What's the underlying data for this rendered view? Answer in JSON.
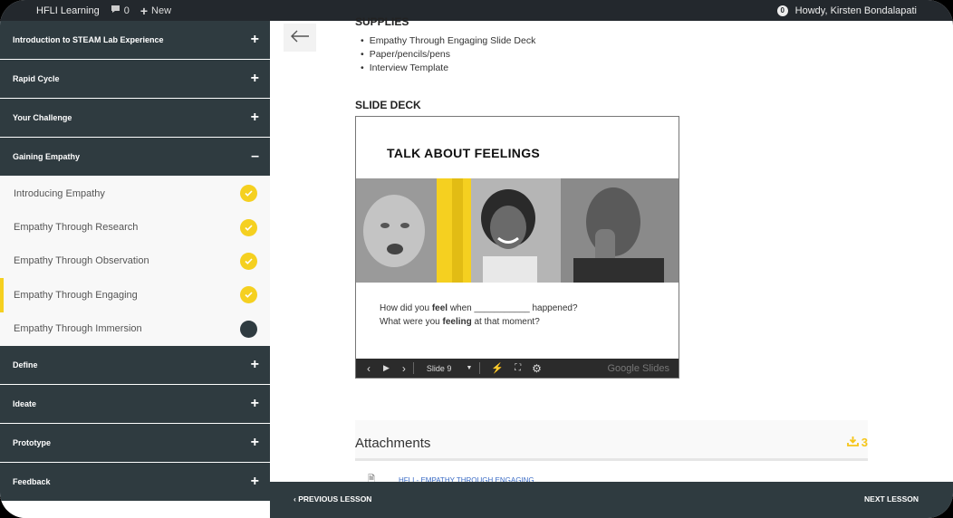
{
  "admin_bar": {
    "site_title": "HFLI Learning",
    "comments_count": "0",
    "new_label": "New",
    "notifications_count": "0",
    "greeting": "Howdy, Kirsten Bondalapati"
  },
  "sidebar": {
    "sections_top": [
      {
        "label": "Introduction to STEAM Lab Experience",
        "symbol": "+"
      },
      {
        "label": "Rapid Cycle",
        "symbol": "+"
      },
      {
        "label": "Your Challenge",
        "symbol": "+"
      },
      {
        "label": "Gaining Empathy",
        "symbol": "–"
      }
    ],
    "lessons": [
      {
        "label": "Introducing Empathy",
        "status": "complete"
      },
      {
        "label": "Empathy Through Research",
        "status": "complete"
      },
      {
        "label": "Empathy Through Observation",
        "status": "complete"
      },
      {
        "label": "Empathy Through Engaging",
        "status": "complete"
      },
      {
        "label": "Empathy Through Immersion",
        "status": "incomplete"
      }
    ],
    "sections_bottom": [
      {
        "label": "Define",
        "symbol": "+"
      },
      {
        "label": "Ideate",
        "symbol": "+"
      },
      {
        "label": "Prototype",
        "symbol": "+"
      },
      {
        "label": "Feedback",
        "symbol": "+"
      }
    ]
  },
  "content": {
    "supplies_heading": "SUPPLIES",
    "supplies": [
      "Empathy Through Engaging Slide Deck",
      "Paper/pencils/pens",
      "Interview Template"
    ],
    "slide_deck_heading": "SLIDE DECK",
    "slide": {
      "title": "TALK ABOUT FEELINGS",
      "q1_a": "How did you ",
      "q1_b": "feel",
      "q1_c": " when ___________ happened?",
      "q2_a": "What were you ",
      "q2_b": "feeling",
      "q2_c": " at that moment?",
      "slide_label": "Slide 9",
      "brand": "Google Slides"
    },
    "attachments_heading": "Attachments",
    "attachments_count": "3",
    "attachment_file": "HFLI - EMPATHY THROUGH ENGAGING"
  },
  "bottom_nav": {
    "prev_label": "PREVIOUS LESSON",
    "next_label": "NEXT LESSON"
  },
  "colors": {
    "accent": "#f5d020",
    "sidebar_dark": "#2f3b40",
    "admin_bar": "#23282d"
  }
}
